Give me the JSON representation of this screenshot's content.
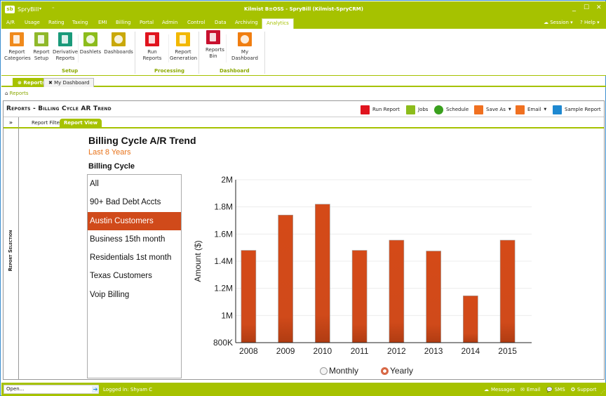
{
  "window": {
    "app_name": "SpryBill",
    "logo_text": "sb",
    "title": "Kilmist B≡OSS - SpryBill (Kilmist-SpryCRM)",
    "controls": [
      "_",
      "☐",
      "✕"
    ]
  },
  "menu": {
    "tabs": [
      "A/R",
      "Usage",
      "Rating",
      "Taxing",
      "EMI",
      "Billing",
      "Portal",
      "Admin",
      "Control",
      "Data",
      "Archiving",
      "Analytics"
    ],
    "active": "Analytics",
    "session_label": "Session",
    "help_label": "Help"
  },
  "ribbon": {
    "groups": [
      {
        "label": "Setup",
        "buttons": [
          {
            "label": "Report Categories",
            "icon": "report-categories-icon",
            "color": "#f08a1c"
          },
          {
            "label": "Report Setup",
            "icon": "report-setup-icon",
            "color": "#8fb82a"
          },
          {
            "label": "Derivative Reports",
            "icon": "derivative-reports-icon",
            "color": "#1a9a7a"
          },
          {
            "label": "Dashlets",
            "icon": "dashlets-icon",
            "color": "#8cbc1c"
          },
          {
            "label": "Dashboards",
            "icon": "dashboards-icon",
            "color": "#c9a80a"
          }
        ]
      },
      {
        "label": "Processing",
        "buttons": [
          {
            "label": "Run Reports",
            "icon": "run-reports-icon",
            "color": "#e0141e"
          },
          {
            "label": "Report Generation",
            "icon": "report-generation-icon",
            "color": "#f2b800"
          }
        ]
      },
      {
        "label": "Dashboard",
        "buttons": [
          {
            "label": "Reports Bin",
            "icon": "reports-bin-icon",
            "color": "#c8102e"
          },
          {
            "label": "My Dashboard",
            "icon": "my-dashboard-icon",
            "color": "#f07d10"
          }
        ]
      }
    ]
  },
  "doc_tabs": [
    {
      "label": "Reports",
      "active": true
    },
    {
      "label": "My Dashboard",
      "active": false
    }
  ],
  "breadcrumb": "Reports",
  "panel": {
    "title": "Reports - Billing Cycle AR Trend",
    "toolbar": [
      {
        "label": "Run Report",
        "icon": "run-report-icon",
        "color": "#e0141e",
        "dropdown": false
      },
      {
        "label": "Jobs",
        "icon": "jobs-icon",
        "color": "#8cbc1c",
        "dropdown": false
      },
      {
        "label": "Schedule",
        "icon": "schedule-icon",
        "color": "#3aa01e",
        "dropdown": false
      },
      {
        "label": "Save As",
        "icon": "save-as-icon",
        "color": "#f07020",
        "dropdown": true
      },
      {
        "label": "Email",
        "icon": "email-icon",
        "color": "#f07020",
        "dropdown": true
      },
      {
        "label": "Sample Report",
        "icon": "sample-report-icon",
        "color": "#1e88d0",
        "dropdown": false
      }
    ],
    "expander": "»",
    "subtabs": [
      {
        "label": "Report Filter",
        "active": false
      },
      {
        "label": "Report View",
        "active": true
      }
    ],
    "sidebar_label": "Report Selection"
  },
  "report": {
    "title": "Billing Cycle A/R Trend",
    "subtitle": "Last 8 Years",
    "list_label": "Billing Cycle",
    "billing_cycles": [
      "All",
      "90+ Bad Debt Accts",
      "Austin Customers",
      "Business 15th month",
      "Residentials 1st month",
      "Texas Customers",
      "Voip Billing"
    ],
    "selected_cycle": "Austin Customers",
    "period_options": [
      "Monthly",
      "Yearly"
    ],
    "selected_period": "Yearly"
  },
  "chart_data": {
    "type": "bar",
    "title": "Billing Cycle A/R Trend",
    "categories": [
      "2008",
      "2009",
      "2010",
      "2011",
      "2012",
      "2013",
      "2014",
      "2015"
    ],
    "values": [
      1480000,
      1740000,
      1820000,
      1480000,
      1555000,
      1475000,
      1145000,
      1555000
    ],
    "xlabel": "",
    "ylabel": "Amount ($)",
    "ylim": [
      800000,
      2000000
    ],
    "yticks": [
      800000,
      1000000,
      1200000,
      1400000,
      1600000,
      1800000,
      2000000
    ],
    "ytick_labels": [
      "800K",
      "1M",
      "1.2M",
      "1.4M",
      "1.6M",
      "1.8M",
      "2M"
    ],
    "grid": true,
    "bar_color": "#d04a1a"
  },
  "statusbar": {
    "open_placeholder": "Open...",
    "logged_in": "Logged in:  Shyam C",
    "items": [
      {
        "label": "Messages",
        "icon": "messages-icon"
      },
      {
        "label": "Email",
        "icon": "email-icon"
      },
      {
        "label": "SMS",
        "icon": "sms-icon"
      },
      {
        "label": "Support",
        "icon": "support-icon"
      }
    ]
  }
}
